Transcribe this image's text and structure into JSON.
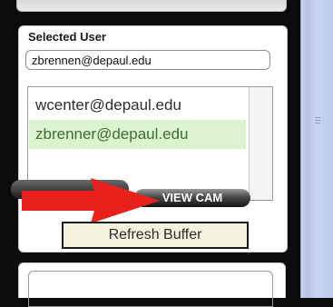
{
  "panel": {
    "title": "Selected User",
    "selected_user": "zbrennen@depaul.edu"
  },
  "user_list": {
    "items": [
      {
        "label": "wcenter@depaul.edu",
        "selected": false
      },
      {
        "label": "zbrenner@depaul.edu",
        "selected": true
      }
    ]
  },
  "buttons": {
    "view_cam": "VIEW CAM"
  },
  "tooltip": {
    "text": "Refresh Buffer"
  },
  "colors": {
    "selected_row": "#dbf3cf",
    "arrow": "#e8211c",
    "tooltip_bg": "#f4f1dc"
  },
  "icons": {
    "pointer": "red-arrow-icon",
    "grip": "drag-grip-icon"
  }
}
